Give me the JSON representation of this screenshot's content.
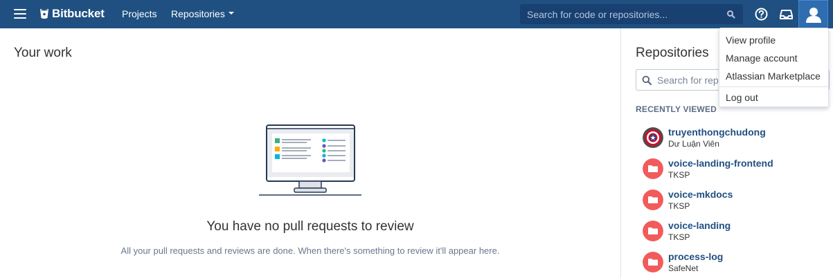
{
  "header": {
    "logo_text": "Bitbucket",
    "nav": {
      "projects": "Projects",
      "repositories": "Repositories"
    },
    "search_placeholder": "Search for code or repositories...",
    "icons": [
      "menu-icon",
      "bitbucket-logo-icon",
      "search-icon",
      "help-icon",
      "inbox-icon",
      "user-avatar-icon"
    ],
    "brand_color": "#205081"
  },
  "main": {
    "title": "Your work",
    "empty_title": "You have no pull requests to review",
    "empty_desc": "All your pull requests and reviews are done. When there's something to review it'll appear here."
  },
  "sidebar": {
    "title": "Repositories",
    "search_placeholder": "Search for repositories",
    "recent_label": "RECENTLY VIEWED",
    "repos": [
      {
        "name": "truyenthongchudong",
        "owner": "Dư Luận Viên",
        "avatar": "captain-shield"
      },
      {
        "name": "voice-landing-frontend",
        "owner": "TKSP",
        "avatar": "folder"
      },
      {
        "name": "voice-mkdocs",
        "owner": "TKSP",
        "avatar": "folder"
      },
      {
        "name": "voice-landing",
        "owner": "TKSP",
        "avatar": "folder"
      },
      {
        "name": "process-log",
        "owner": "SafeNet",
        "avatar": "folder"
      }
    ]
  },
  "user_menu": {
    "items": [
      "View profile",
      "Manage account",
      "Atlassian Marketplace",
      "Log out"
    ]
  }
}
